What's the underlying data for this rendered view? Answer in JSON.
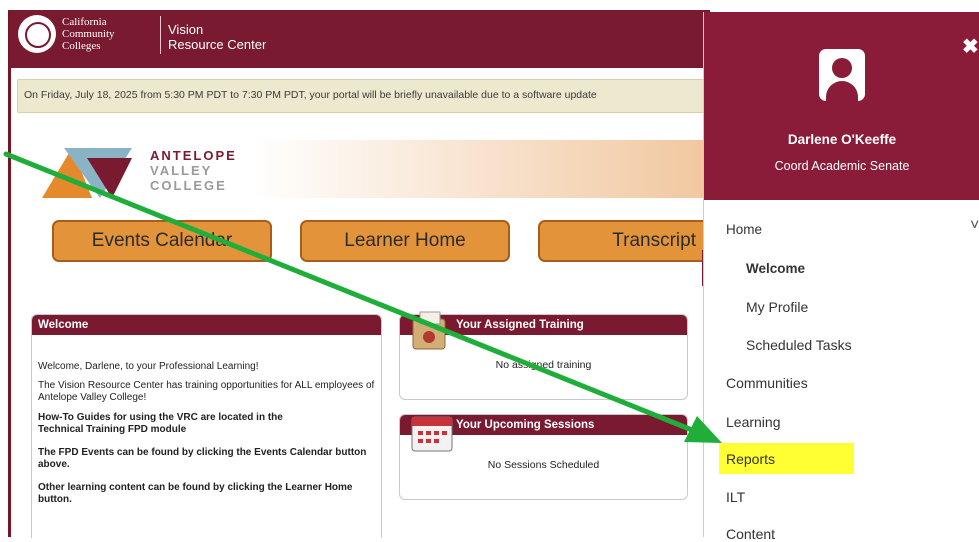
{
  "header": {
    "org_name_line1": "California",
    "org_name_line2": "Community",
    "org_name_line3": "Colleges",
    "site_name_line1": "Vision",
    "site_name_line2": "Resource Center"
  },
  "notice": {
    "text": "On Friday, July 18, 2025 from 5:30 PM PDT to 7:30 PM PDT, your portal will be briefly unavailable due to a software update"
  },
  "college": {
    "name_line1": "ANTELOPE",
    "name_line2": "VALLEY",
    "name_line3": "COLLEGE"
  },
  "buttons": {
    "events_calendar": "Events Calendar",
    "learner_home": "Learner Home",
    "transcript": "Transcript"
  },
  "welcome": {
    "title": "Welcome",
    "greeting": "Welcome, Darlene, to your Professional Learning!",
    "vrc_text": "The Vision Resource Center has training opportunities for ALL employees of Antelope Valley College!",
    "howto_text": "How-To Guides for using the VRC are located in the",
    "howto_link": "Technical Training FPD module",
    "fpd_events": "The FPD Events can be found by clicking the Events Calendar button above.",
    "other_content": "Other learning content can be found by clicking the Learner Home button."
  },
  "assigned_training": {
    "title": "Your Assigned Training",
    "empty_text": "No assigned training"
  },
  "upcoming_sessions": {
    "title": "Your Upcoming Sessions",
    "empty_text": "No Sessions Scheduled"
  },
  "profile_panel": {
    "user_name": "Darlene O'Keeffe",
    "user_title": "Coord Academic Senate",
    "close_symbol": "✖",
    "nav": {
      "home": "Home",
      "home_children": [
        "Welcome",
        "My Profile",
        "Scheduled Tasks"
      ],
      "communities": "Communities",
      "learning": "Learning",
      "reports": "Reports",
      "ilt": "ILT",
      "content": "Content"
    }
  },
  "colors": {
    "brand_maroon": "#7a1a30",
    "panel_maroon": "#8a1c3a",
    "button_orange": "#e3943a",
    "highlight_yellow": "#ffff33",
    "annotation_arrow": "#1fae3a"
  }
}
